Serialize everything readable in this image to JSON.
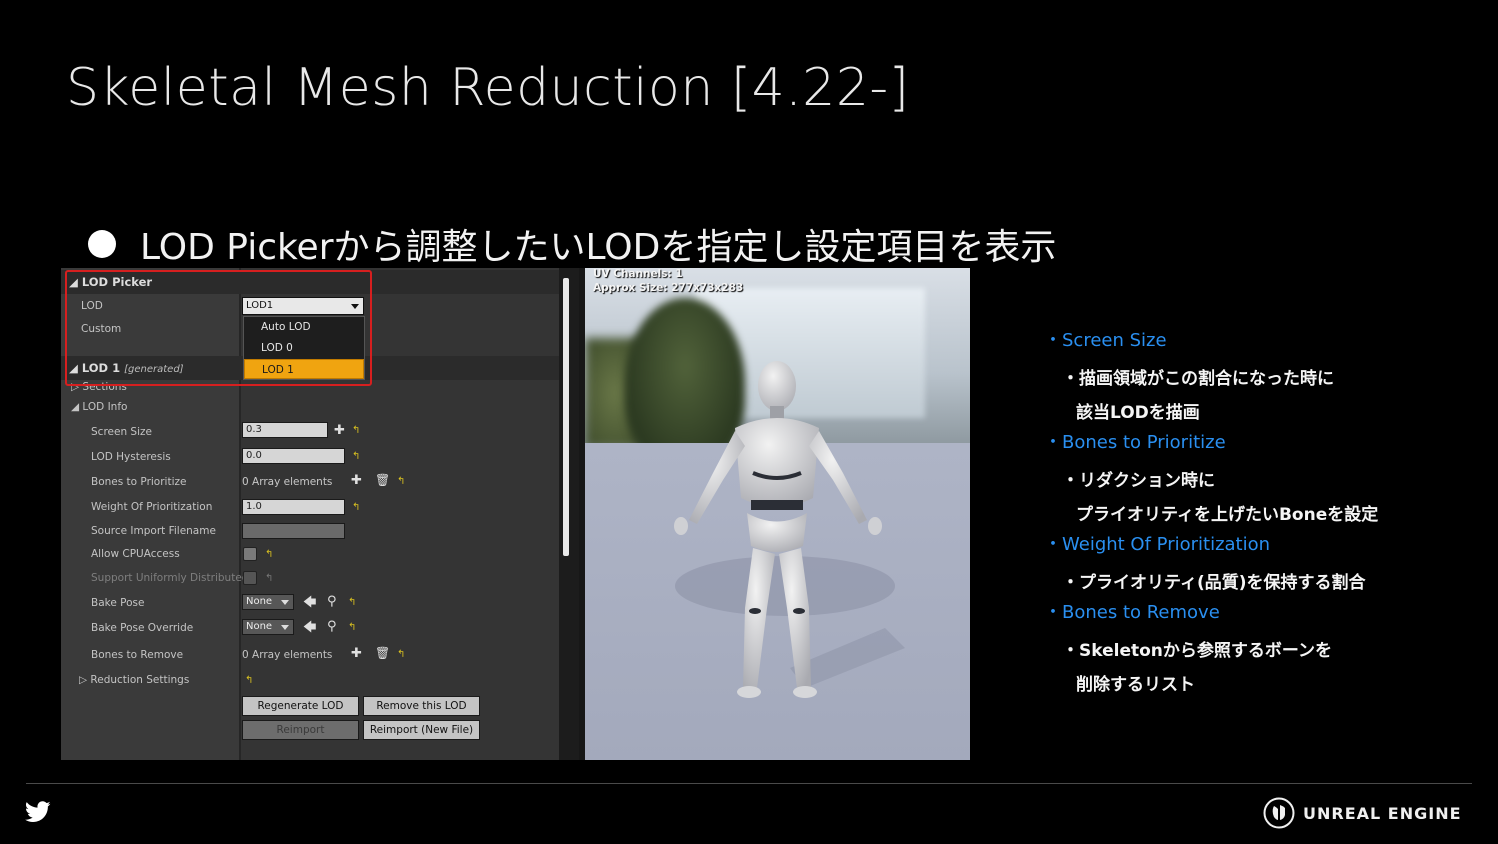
{
  "slide": {
    "title": "Skeletal Mesh Reduction [4.22-]",
    "bullet": "LOD Pickerから調整したいLODを指定し設定項目を表示"
  },
  "editor": {
    "lod_picker": {
      "section": "LOD Picker",
      "lod_label": "LOD",
      "lod_value": "LOD1",
      "custom_label": "Custom",
      "menu": [
        "Auto LOD",
        "LOD 0",
        "LOD 1"
      ],
      "selected_index": 2
    },
    "lod1": {
      "section": "LOD 1",
      "tag": "[generated]",
      "sections_label": "Sections",
      "lod_info_label": "LOD Info"
    },
    "rows": {
      "screen_size": {
        "label": "Screen Size",
        "value": "0.3"
      },
      "lod_hysteresis": {
        "label": "LOD Hysteresis",
        "value": "0.0"
      },
      "bones_to_prioritize": {
        "label": "Bones to Prioritize",
        "value": "0 Array elements"
      },
      "weight_of_prioritization": {
        "label": "Weight Of Prioritization",
        "value": "1.0"
      },
      "source_import_filename": {
        "label": "Source Import Filename",
        "value": ""
      },
      "allow_cpu_access": {
        "label": "Allow CPUAccess"
      },
      "support_uniformly_distributed": {
        "label": "Support Uniformly Distributed"
      },
      "bake_pose": {
        "label": "Bake Pose",
        "value": "None"
      },
      "bake_pose_override": {
        "label": "Bake Pose Override",
        "value": "None"
      },
      "bones_to_remove": {
        "label": "Bones to Remove",
        "value": "0 Array elements"
      },
      "reduction_settings": {
        "label": "Reduction Settings"
      }
    },
    "buttons": {
      "regenerate": "Regenerate LOD",
      "remove": "Remove this LOD",
      "reimport": "Reimport",
      "reimport_new": "Reimport (New File)"
    }
  },
  "viewport": {
    "uv_channels": "UV Channels: 1",
    "approx_size": "Approx Size: 277x73x283"
  },
  "info": [
    {
      "type": "h",
      "text": "・Screen Size"
    },
    {
      "type": "t",
      "text": "・描画領域がこの割合になった時に"
    },
    {
      "type": "t2",
      "text": "該当LODを描画"
    },
    {
      "type": "h",
      "text": "・Bones to Prioritize"
    },
    {
      "type": "t",
      "text": "・リダクション時に"
    },
    {
      "type": "t2",
      "text": "プライオリティを上げたいBoneを設定"
    },
    {
      "type": "h",
      "text": "・Weight Of Prioritization"
    },
    {
      "type": "t",
      "text": "・プライオリティ(品質)を保持する割合"
    },
    {
      "type": "h",
      "text": "・Bones to Remove"
    },
    {
      "type": "t",
      "text": "・Skeletonから参照するボーンを"
    },
    {
      "type": "t2",
      "text": "削除するリスト"
    }
  ],
  "footer": {
    "brand": "UNREAL ENGINE",
    "social_icon": "twitter-icon"
  },
  "colors": {
    "accent_blue": "#2a8ff0",
    "highlight_orange": "#f0a410",
    "red_outline": "#d61f1f"
  }
}
